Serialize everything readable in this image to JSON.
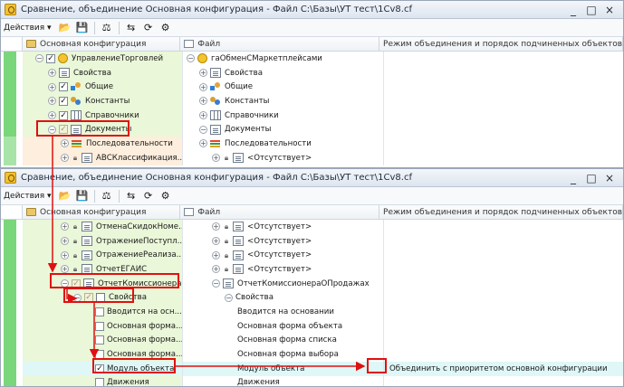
{
  "window1": {
    "title": "Сравнение, объединение Основная конфигурация - Файл C:\\Базы\\УТ тест\\1Cv8.cf",
    "actions_label": "Действия",
    "columns": {
      "main": "Основная конфигурация",
      "file": "Файл",
      "mode": "Режим объединения и порядок подчиненных объектов"
    },
    "rows": [
      {
        "a": "УправлениеТорговлей",
        "b": "гаОбменСМаркетплейсами",
        "c": ""
      },
      {
        "a": "Свойства",
        "b": "Свойства",
        "c": ""
      },
      {
        "a": "Общие",
        "b": "Общие",
        "c": ""
      },
      {
        "a": "Константы",
        "b": "Константы",
        "c": ""
      },
      {
        "a": "Справочники",
        "b": "Справочники",
        "c": ""
      },
      {
        "a": "Документы",
        "b": "Документы",
        "c": ""
      },
      {
        "a": "Последовательности",
        "b": "Последовательности",
        "c": ""
      },
      {
        "a": "АВСКлассификация...",
        "b": "<Отсутствует>",
        "c": ""
      }
    ]
  },
  "window2": {
    "title": "Сравнение, объединение Основная конфигурация - Файл C:\\Базы\\УТ тест\\1Cv8.cf",
    "actions_label": "Действия",
    "columns": {
      "main": "Основная конфигурация",
      "file": "Файл",
      "mode": "Режим объединения и порядок подчиненных объектов"
    },
    "rows": [
      {
        "a": "ОтменаСкидокНоме...",
        "b": "<Отсутствует>",
        "c": ""
      },
      {
        "a": "ОтражениеПоступл...",
        "b": "<Отсутствует>",
        "c": ""
      },
      {
        "a": "ОтражениеРеализа...",
        "b": "<Отсутствует>",
        "c": ""
      },
      {
        "a": "ОтчетЕГАИС",
        "b": "<Отсутствует>",
        "c": ""
      },
      {
        "a": "ОтчетКомиссионера...",
        "b": "ОтчетКомиссионераОПродажах",
        "c": ""
      },
      {
        "a": "Свойства",
        "b": "Свойства",
        "c": ""
      },
      {
        "a": "Вводится на осн...",
        "b": "Вводится на основании",
        "c": ""
      },
      {
        "a": "Основная форма...",
        "b": "Основная форма объекта",
        "c": ""
      },
      {
        "a": "Основная форма...",
        "b": "Основная форма списка",
        "c": ""
      },
      {
        "a": "Основная форма...",
        "b": "Основная форма выбора",
        "c": ""
      },
      {
        "a": "Модуль объекта",
        "b": "Модуль объекта",
        "c": "Объединить с приоритетом основной конфигурации"
      },
      {
        "a": "Движения",
        "b": "Движения",
        "c": ""
      }
    ]
  },
  "window_buttons": {
    "minimize": "_",
    "maximize": "□",
    "close": "×"
  },
  "icons": [
    "app-icon",
    "new-icon",
    "save-icon",
    "compare-icon",
    "merge-icon",
    "refresh-icon",
    "settings-icon",
    "gear-icon",
    "expand-icon",
    "collapse-icon",
    "lock-icon",
    "checkbox-icon"
  ],
  "colors": {
    "highlight": "#e01010",
    "green_gutter": "#7ad67a",
    "main_col_bg": "#eaf7d8",
    "selected_row_bg": "#dff7f7"
  }
}
